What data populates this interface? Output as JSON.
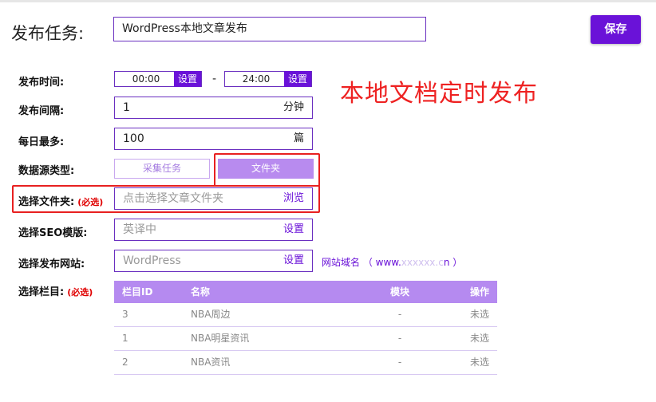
{
  "header": {
    "task_label": "发布任务:",
    "task_value": "WordPress本地文章发布",
    "save_label": "保存"
  },
  "overlay_title": "本地文档定时发布",
  "publish_time": {
    "label": "发布时间:",
    "start": "00:00",
    "end": "24:00",
    "set_label": "设置",
    "separator": "-"
  },
  "interval": {
    "label": "发布间隔:",
    "value": "1",
    "unit": "分钟"
  },
  "daily_max": {
    "label": "每日最多:",
    "value": "100",
    "unit": "篇"
  },
  "source_type": {
    "label": "数据源类型:",
    "options": [
      "采集任务",
      "文件夹"
    ],
    "selected": "文件夹"
  },
  "folder": {
    "label": "选择文件夹:",
    "required": "(必选)",
    "placeholder": "点击选择文章文件夹",
    "browse": "浏览"
  },
  "seo_template": {
    "label": "选择SEO模版:",
    "value": "英译中",
    "action": "设置"
  },
  "site": {
    "label": "选择发布网站:",
    "value": "WordPress",
    "action": "设置",
    "domain_prefix": "网站域名 （ www.",
    "domain_hidden": "xxxxxx.c",
    "domain_suffix": "n ）"
  },
  "column": {
    "label": "选择栏目:",
    "required": "(必选)",
    "headers": [
      "栏目ID",
      "名称",
      "模块",
      "操作"
    ],
    "rows": [
      {
        "id": "3",
        "name": "NBA周边",
        "module": "-",
        "op": "未选"
      },
      {
        "id": "1",
        "name": "NBA明星资讯",
        "module": "-",
        "op": "未选"
      },
      {
        "id": "2",
        "name": "NBA资讯",
        "module": "-",
        "op": "未选"
      }
    ]
  },
  "colors": {
    "accent": "#6a12d8",
    "table_header": "#b58af0",
    "highlight": "#e82020"
  }
}
